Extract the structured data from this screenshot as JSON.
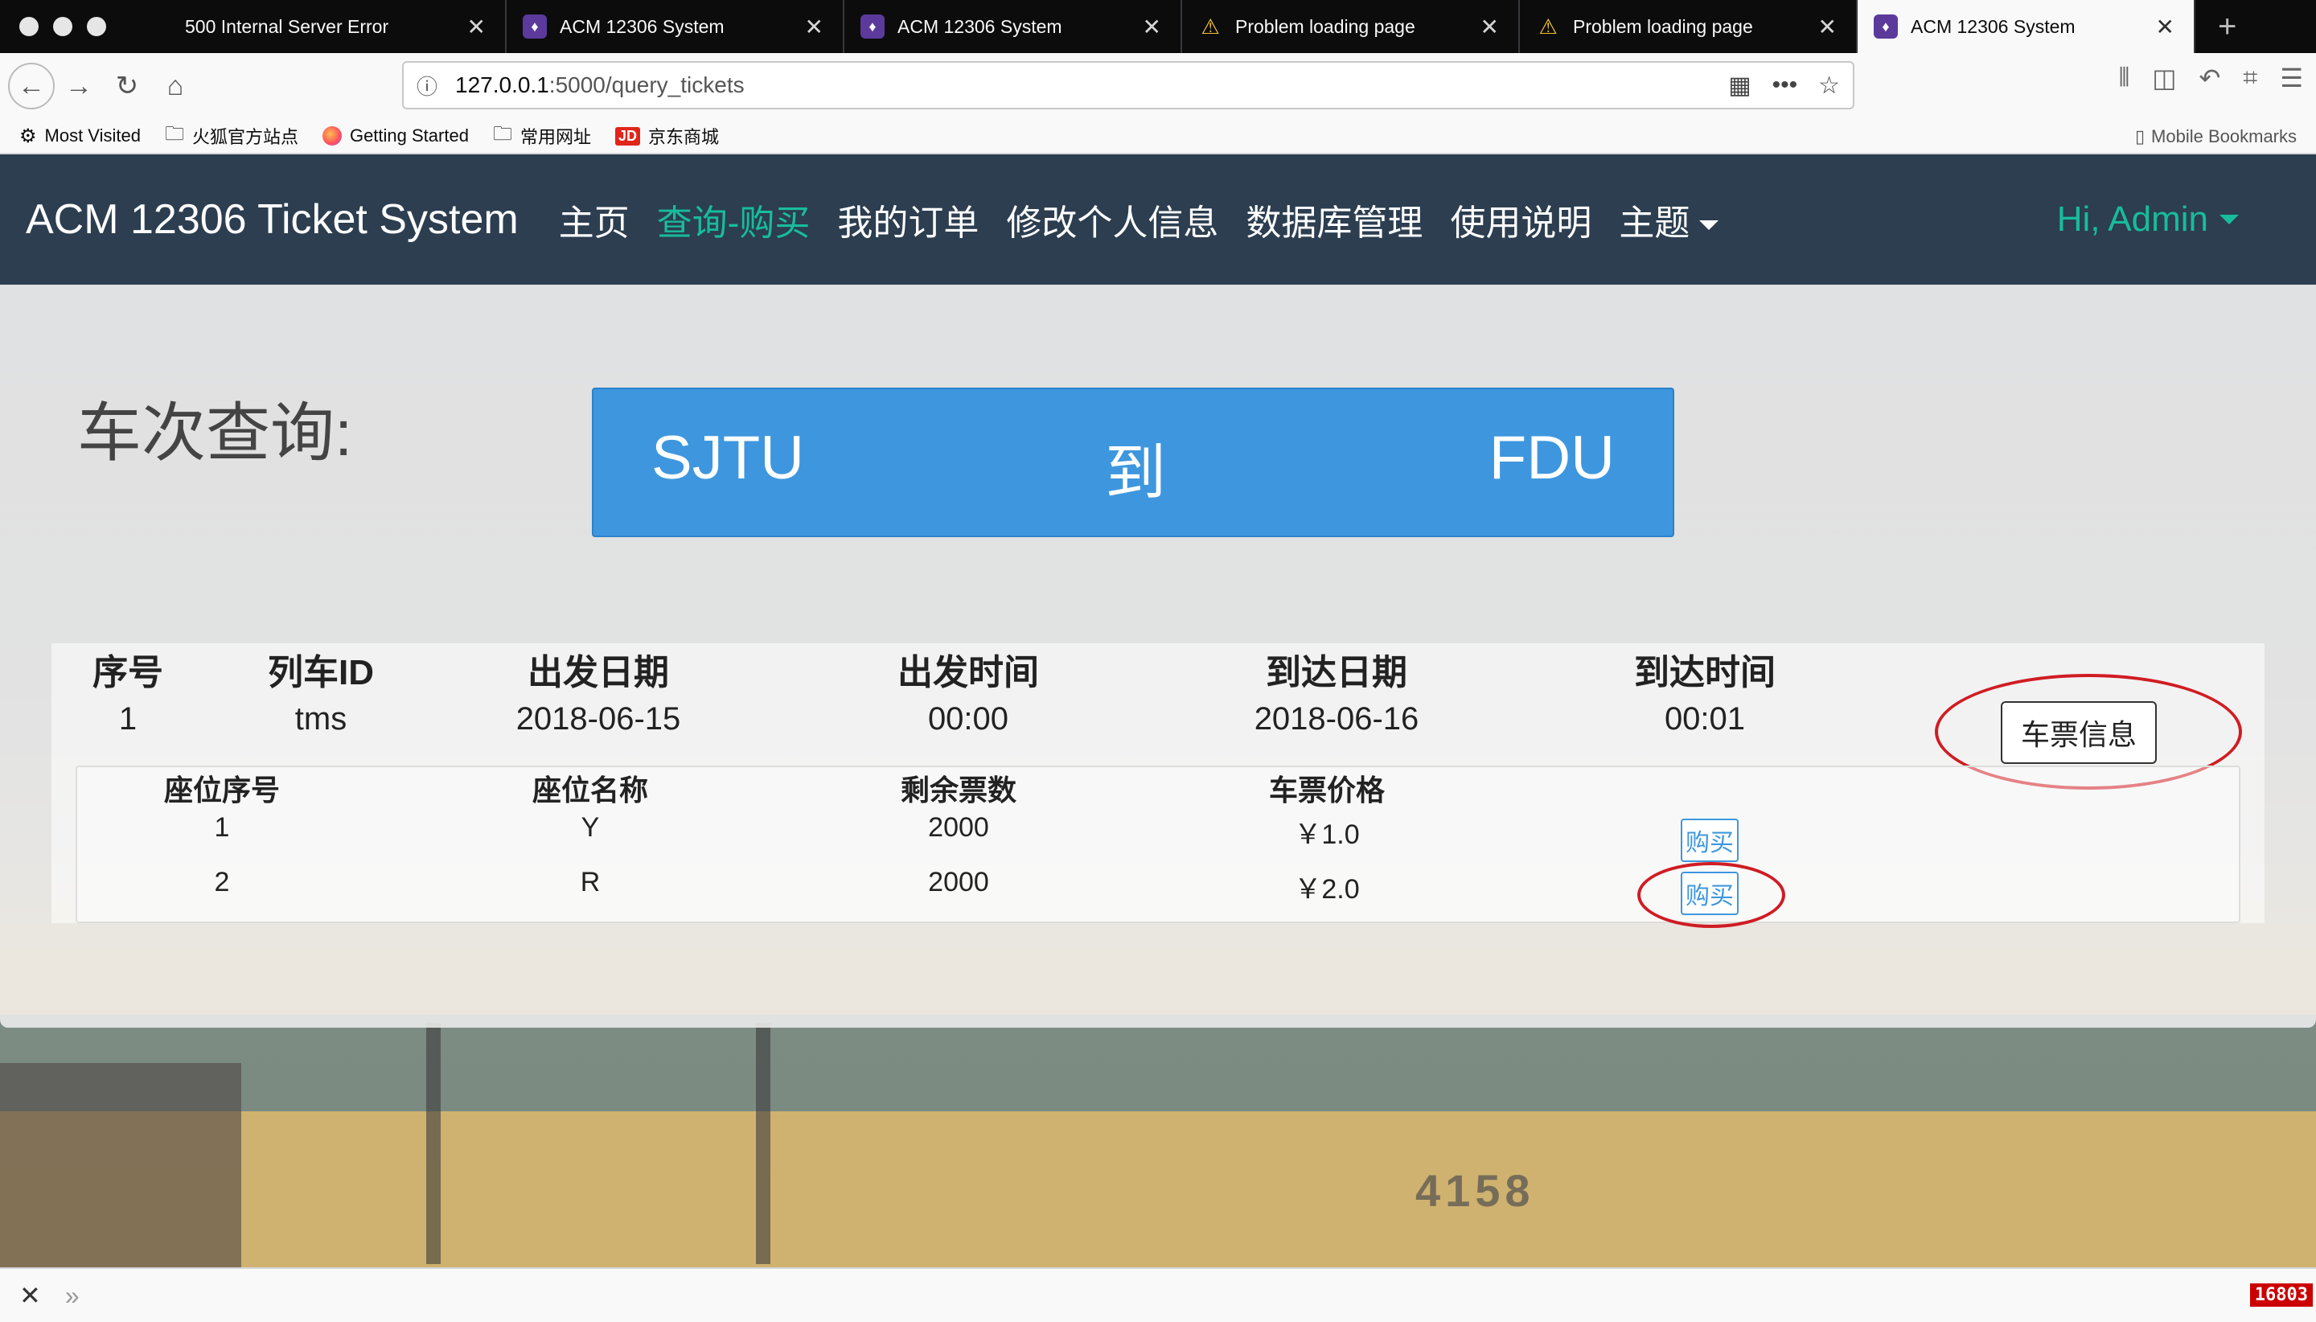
{
  "browser": {
    "tabs": [
      {
        "title": "500 Internal Server Error",
        "icon": "none",
        "active": false
      },
      {
        "title": "ACM 12306 System",
        "icon": "acm-favicon",
        "active": false
      },
      {
        "title": "ACM 12306 System",
        "icon": "acm-favicon",
        "active": false
      },
      {
        "title": "Problem loading page",
        "icon": "warning-icon",
        "active": false
      },
      {
        "title": "Problem loading page",
        "icon": "warning-icon",
        "active": false
      },
      {
        "title": "ACM 12306 System",
        "icon": "acm-favicon",
        "active": true
      }
    ],
    "url_host": "127.0.0.1",
    "url_path": ":5000/query_tickets",
    "bookmarks": [
      {
        "label": "Most Visited",
        "icon": "gear-icon"
      },
      {
        "label": "火狐官方站点",
        "icon": "folder-icon"
      },
      {
        "label": "Getting Started",
        "icon": "firefox-icon"
      },
      {
        "label": "常用网址",
        "icon": "folder-icon"
      },
      {
        "label": "京东商城",
        "icon": "jd-icon"
      }
    ],
    "mobile_bookmarks": "Mobile Bookmarks",
    "status_counter": "16803"
  },
  "site": {
    "brand": "ACM 12306 Ticket System",
    "nav": [
      "主页",
      "查询-购买",
      "我的订单",
      "修改个人信息",
      "数据库管理",
      "使用说明",
      "主题"
    ],
    "active_nav": "查询-购买",
    "user": "Hi, Admin",
    "accent_color": "#18bc9c",
    "navbar_color": "#2c3e50"
  },
  "query": {
    "label": "车次查询:",
    "from": "SJTU",
    "sep": "到",
    "to": "FDU",
    "box_color": "#3e97de"
  },
  "results": {
    "headers": [
      "序号",
      "列车ID",
      "出发日期",
      "出发时间",
      "到达日期",
      "到达时间"
    ],
    "row": [
      "1",
      "tms",
      "2018-06-15",
      "00:00",
      "2018-06-16",
      "00:01"
    ],
    "ticket_button": "车票信息",
    "seat_headers": [
      "座位序号",
      "座位名称",
      "剩余票数",
      "车票价格"
    ],
    "seats": [
      {
        "no": "1",
        "name": "Y",
        "remaining": "2000",
        "price": "￥1.0",
        "buy": "购买"
      },
      {
        "no": "2",
        "name": "R",
        "remaining": "2000",
        "price": "￥2.0",
        "buy": "购买"
      }
    ],
    "highlight_color": "#d01c23"
  }
}
